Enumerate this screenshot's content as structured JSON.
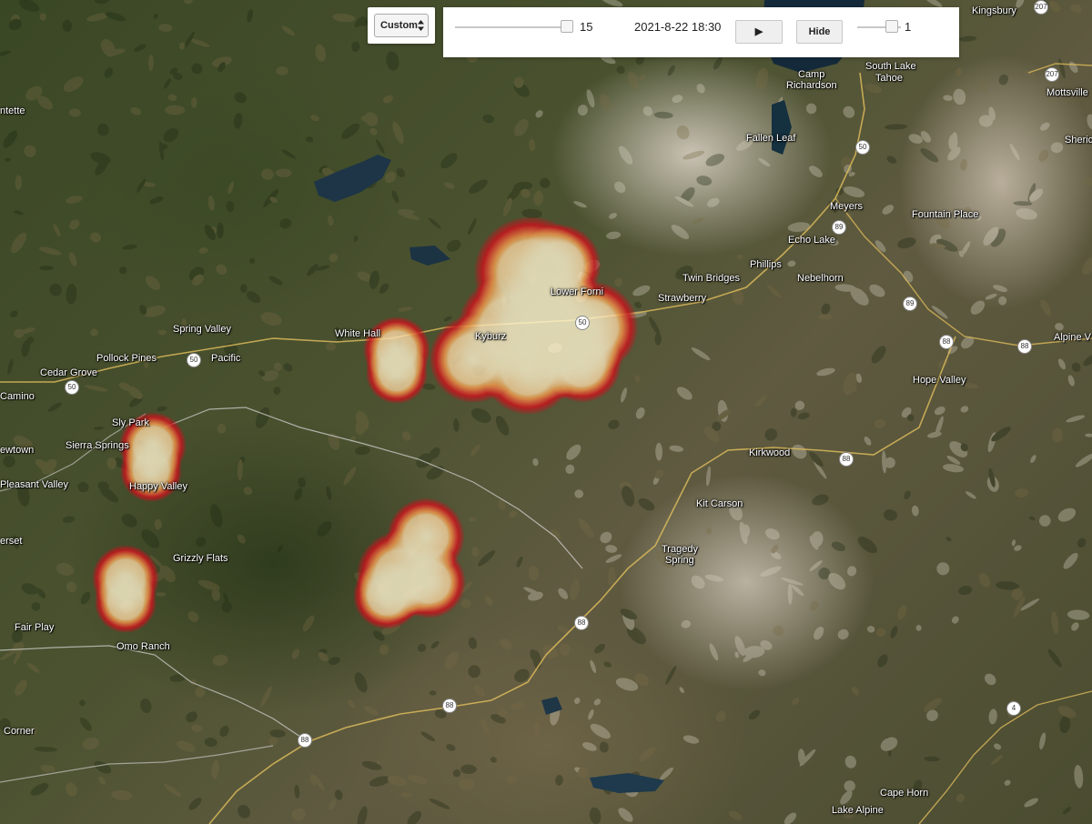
{
  "controls": {
    "map_type": {
      "selected": "Custom",
      "arrows_icon": "up-down-arrows-icon"
    },
    "frame_slider": {
      "value": 15,
      "value_label": "15"
    },
    "timestamp": "2021-8-22 18:30",
    "play_button": {
      "label": "▶",
      "icon": "play-icon"
    },
    "hide_button": {
      "label": "Hide"
    },
    "opacity_slider": {
      "value": 1,
      "value_label": "1"
    }
  },
  "map": {
    "places": [
      {
        "name": "Kingsbury"
      },
      {
        "name": "Camp Richardson",
        "line1": "Camp",
        "line2": "Richardson"
      },
      {
        "name": "South Lake Tahoe",
        "line1": "South Lake",
        "line2": "Tahoe"
      },
      {
        "name": "Mottsville"
      },
      {
        "name": "Sheric"
      },
      {
        "name": "Fallen Leaf"
      },
      {
        "name": "Meyers"
      },
      {
        "name": "Fountain Place"
      },
      {
        "name": "Echo Lake"
      },
      {
        "name": "Phillips"
      },
      {
        "name": "Twin Bridges"
      },
      {
        "name": "Nebelhorn"
      },
      {
        "name": "Strawberry"
      },
      {
        "name": "Lower Forni"
      },
      {
        "name": "Kyburz"
      },
      {
        "name": "White Hall"
      },
      {
        "name": "Spring Valley"
      },
      {
        "name": "Pollock Pines"
      },
      {
        "name": "Pacific"
      },
      {
        "name": "Cedar Grove"
      },
      {
        "name": "Camino"
      },
      {
        "name": "ntette"
      },
      {
        "name": "Sly Park"
      },
      {
        "name": "Sierra Springs"
      },
      {
        "name": "ewtown"
      },
      {
        "name": "Pleasant Valley"
      },
      {
        "name": "Happy Valley"
      },
      {
        "name": "erset"
      },
      {
        "name": "Grizzly Flats"
      },
      {
        "name": "Fair Play"
      },
      {
        "name": "Omo Ranch"
      },
      {
        "name": "Corner"
      },
      {
        "name": "Alpine V"
      },
      {
        "name": "Hope Valley"
      },
      {
        "name": "Kirkwood"
      },
      {
        "name": "Kit Carson"
      },
      {
        "name": "Tragedy Spring",
        "line1": "Tragedy",
        "line2": "Spring"
      },
      {
        "name": "Cape Horn"
      },
      {
        "name": "Lake Alpine"
      }
    ],
    "road_shields": [
      "50",
      "50",
      "50",
      "50",
      "89",
      "89",
      "88",
      "88",
      "88",
      "88",
      "88",
      "88",
      "4",
      "207",
      "207"
    ],
    "heat_colors": {
      "hot": "#fff6d2",
      "mid": "#f0a050",
      "edge": "#c8141e"
    }
  }
}
